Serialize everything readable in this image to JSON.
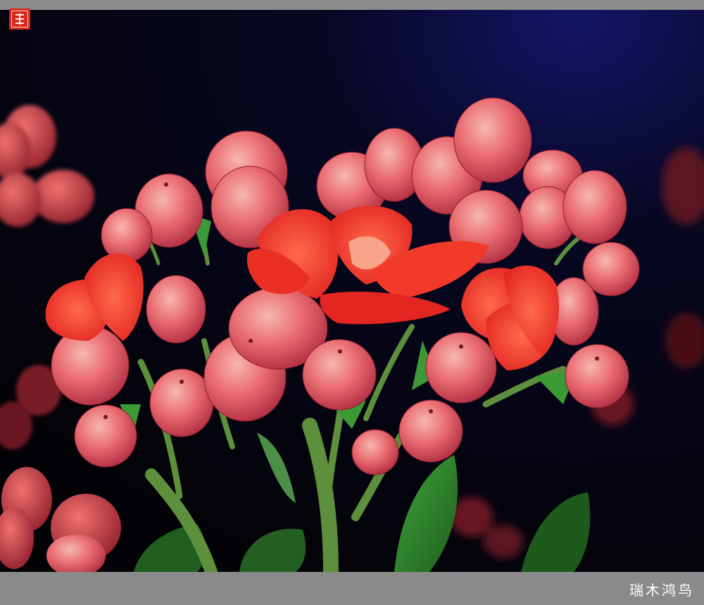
{
  "watermark": {
    "signature_text": "瑞木鸿鸟",
    "seal_icon": "red-seal-stamp-icon"
  },
  "photo": {
    "subject": "kalanchoe-flower-cluster",
    "colors": {
      "background_dark": "#05050c",
      "background_blue": "#141466",
      "petal_red": "#f23a2a",
      "bud_pink": "#e8606a",
      "bud_highlight": "#f7b7b0",
      "leaf_green": "#2f8a2c",
      "stem_green": "#5d8f3c"
    }
  }
}
